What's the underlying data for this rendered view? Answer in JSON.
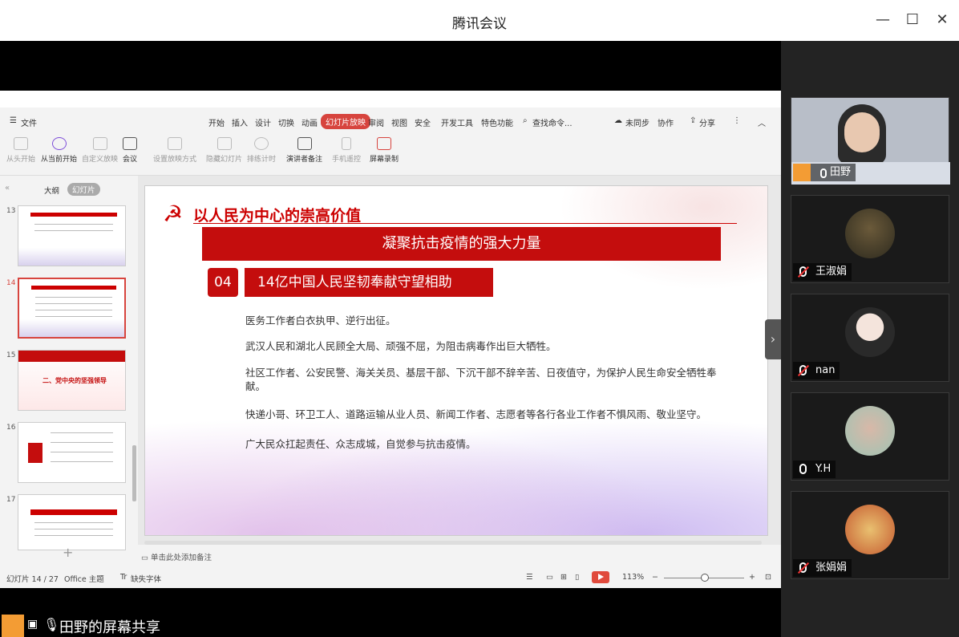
{
  "app": {
    "title": "腾讯会议",
    "window_buttons": {
      "minimize": "—",
      "maximize": "☐",
      "close": "✕"
    }
  },
  "wps": {
    "file_menu": "文件",
    "menu_tabs": [
      "开始",
      "插入",
      "设计",
      "切换",
      "动画",
      "幻灯片放映",
      "审阅",
      "视图",
      "安全",
      "开发工具",
      "特色功能"
    ],
    "active_tab": "幻灯片放映",
    "search_placeholder": "查找命令...",
    "sync_status": "未同步",
    "collab": "协作",
    "share": "分享",
    "tools": [
      "从头开始",
      "从当前开始",
      "自定义放映",
      "会议",
      "设置放映方式",
      "隐藏幻灯片",
      "排练计时",
      "演讲者备注",
      "手机遥控",
      "屏幕录制"
    ],
    "panel_tabs": {
      "outline": "大纲",
      "slides": "幻灯片"
    },
    "thumbnails": [
      {
        "num": "13"
      },
      {
        "num": "14",
        "selected": true
      },
      {
        "num": "15",
        "text": "二、党中央的坚强领导"
      },
      {
        "num": "16"
      },
      {
        "num": "17"
      }
    ],
    "slide": {
      "heading": "以人民为中心的崇高价值",
      "banner": "凝聚抗击疫情的强大力量",
      "number": "04",
      "subtitle": "14亿中国人民坚韧奉献守望相助",
      "bullets": [
        "医务工作者白衣执甲、逆行出征。",
        "武汉人民和湖北人民顾全大局、顽强不屈，为阻击病毒作出巨大牺牲。",
        "社区工作者、公安民警、海关关员、基层干部、下沉干部不辞辛苦、日夜值守，为保护人民生命安全牺牲奉献。",
        "快递小哥、环卫工人、道路运输从业人员、新闻工作者、志愿者等各行各业工作者不惧风雨、敬业坚守。",
        "广大民众扛起责任、众志成城，自觉参与抗击疫情。"
      ]
    },
    "notes_placeholder": "单击此处添加备注",
    "status": {
      "slide_count": "幻灯片 14 / 27",
      "theme": "Office 主题",
      "font_missing": "缺失字体",
      "zoom": "113%"
    }
  },
  "share_label": "田野的屏幕共享",
  "participants": [
    {
      "name": "田野",
      "muted": false,
      "video": true
    },
    {
      "name": "王淑娟",
      "muted": true
    },
    {
      "name": "nan",
      "muted": true
    },
    {
      "name": "Y.H",
      "muted": false
    },
    {
      "name": "张娟娟",
      "muted": true
    }
  ],
  "colors": {
    "accent": "#d7443e",
    "slide_red": "#c40d0d"
  }
}
